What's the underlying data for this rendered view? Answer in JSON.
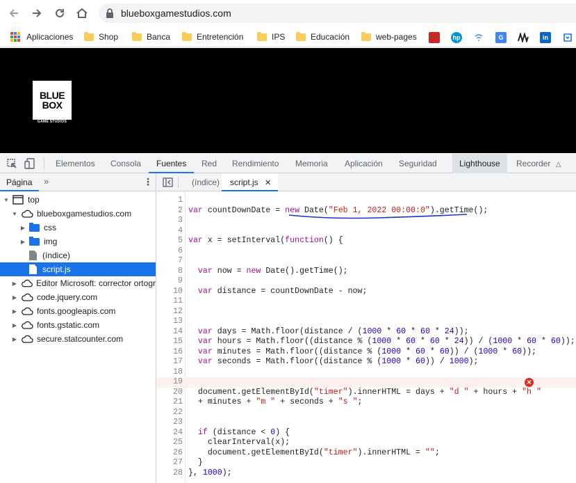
{
  "browser": {
    "url": "blueboxgamestudios.com",
    "bookmarks": [
      {
        "label": "Aplicaciones",
        "type": "apps"
      },
      {
        "label": "Shop",
        "type": "folder"
      },
      {
        "label": "Banca",
        "type": "folder"
      },
      {
        "label": "Entretención",
        "type": "folder"
      },
      {
        "label": "IPS",
        "type": "folder"
      },
      {
        "label": "Educación",
        "type": "folder"
      },
      {
        "label": "web-pages",
        "type": "folder"
      }
    ],
    "extensions": [
      {
        "icon": "red-shield-icon",
        "color": "#c62828",
        "glyph": ""
      },
      {
        "icon": "hp-icon",
        "color": "#0096d6",
        "glyph": "hp"
      },
      {
        "icon": "wifi-signal-icon",
        "color": "#5aa0d0",
        "glyph": ""
      },
      {
        "icon": "translate-icon",
        "color": "#4285f4",
        "glyph": "G"
      },
      {
        "icon": "wave-icon",
        "color": "#222222",
        "glyph": ""
      },
      {
        "icon": "linkedin-icon",
        "color": "#0a66c2",
        "glyph": "in"
      },
      {
        "icon": "save-icon",
        "color": "#1a73e8",
        "glyph": ""
      }
    ]
  },
  "site": {
    "logo_line1": "BLUE",
    "logo_line2": "BOX",
    "logo_sub": "GAME STUDIOS",
    "header_bg": "#000000"
  },
  "devtools": {
    "tabs": [
      "Elementos",
      "Consola",
      "Fuentes",
      "Red",
      "Rendimiento",
      "Memoria",
      "Aplicación",
      "Seguridad",
      "Lighthouse",
      "Recorder"
    ],
    "active_tab": "Fuentes",
    "navigator": {
      "tab_label": "Página",
      "tree": [
        {
          "label": "top",
          "type": "frame",
          "depth": 0,
          "expanded": true
        },
        {
          "label": "blueboxgamestudios.com",
          "type": "cloud",
          "depth": 1,
          "expanded": true
        },
        {
          "label": "css",
          "type": "folder",
          "depth": 2,
          "expanded": false
        },
        {
          "label": "img",
          "type": "folder",
          "depth": 2,
          "expanded": false
        },
        {
          "label": "(índice)",
          "type": "file",
          "depth": 2,
          "expanded": null
        },
        {
          "label": "script.js",
          "type": "file",
          "depth": 2,
          "expanded": null,
          "selected": true
        },
        {
          "label": "Editor Microsoft: corrector ortogr",
          "type": "cloud",
          "depth": 1,
          "expanded": false
        },
        {
          "label": "code.jquery.com",
          "type": "cloud",
          "depth": 1,
          "expanded": false
        },
        {
          "label": "fonts.googleapis.com",
          "type": "cloud",
          "depth": 1,
          "expanded": false
        },
        {
          "label": "fonts.gstatic.com",
          "type": "cloud",
          "depth": 1,
          "expanded": false
        },
        {
          "label": "secure.statcounter.com",
          "type": "cloud",
          "depth": 1,
          "expanded": false
        }
      ]
    },
    "editor": {
      "tabs": [
        "(índice)",
        "script.js"
      ],
      "active_tab": "script.js",
      "error_line": 19,
      "lines": [
        "",
        "var countDownDate = new Date(\"Feb 1, 2022 00:00:0\").getTime();",
        "",
        "",
        "var x = setInterval(function() {",
        "",
        "",
        "  var now = new Date().getTime();",
        "",
        "  var distance = countDownDate - now;",
        "",
        "",
        "",
        "  var days = Math.floor(distance / (1000 * 60 * 60 * 24));",
        "  var hours = Math.floor((distance % (1000 * 60 * 60 * 24)) / (1000 * 60 * 60));",
        "  var minutes = Math.floor((distance % (1000 * 60 * 60)) / (1000 * 60));",
        "  var seconds = Math.floor((distance % (1000 * 60)) / 1000);",
        "",
        "",
        "  document.getElementById(\"timer\").innerHTML = days + \"d \" + hours + \"h \"",
        "  + minutes + \"m \" + seconds + \"s \";",
        "",
        "",
        "  if (distance < 0) {",
        "    clearInterval(x);",
        "    document.getElementById(\"timer\").innerHTML = \"\";",
        "  }",
        "}, 1000);"
      ]
    }
  },
  "colors": {
    "accent": "#1a73e8",
    "error": "#d93025",
    "annotation": "#1a33c8"
  }
}
